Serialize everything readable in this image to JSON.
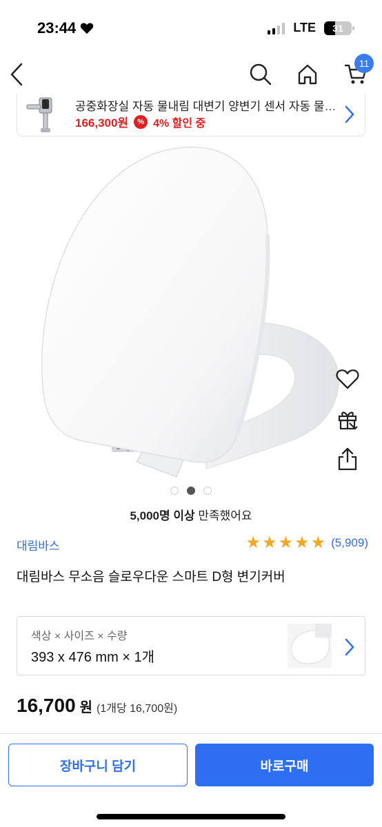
{
  "status_bar": {
    "time": "23:44",
    "network": "LTE",
    "battery": "31"
  },
  "nav": {
    "cart_count": "11"
  },
  "promo": {
    "title": "공중화장실 자동 물내림 대변기 양변기 센서 자동 물내림 장치",
    "price": "166,300원",
    "discount_badge": "%",
    "discount_text": "4% 할인 중"
  },
  "gallery": {
    "total": 3,
    "active_index": 1
  },
  "satisfaction": {
    "count": "5,000명 이상",
    "suffix": "만족했어요"
  },
  "product": {
    "brand": "대림바스",
    "rating": 5,
    "rating_symbol": "★",
    "review_count": "(5,909)",
    "title": "대림바스 무소음 슬로우다운 스마트 D형 변기커버"
  },
  "option": {
    "label": "색상 × 사이즈 × 수량",
    "value": "393 x 476 mm × 1개"
  },
  "price": {
    "amount": "16,700",
    "currency": "원",
    "unit_price": "(1개당 16,700원)"
  },
  "actions": {
    "add_to_cart": "장바구니 담기",
    "buy_now": "바로구매"
  },
  "colors": {
    "accent": "#2e6ff2",
    "discount_red": "#e02020",
    "star": "#f5a623"
  },
  "icons": [
    "back-icon",
    "search-icon",
    "home-icon",
    "cart-icon",
    "heart-icon",
    "gift-icon",
    "share-icon",
    "chevron-right-icon"
  ]
}
